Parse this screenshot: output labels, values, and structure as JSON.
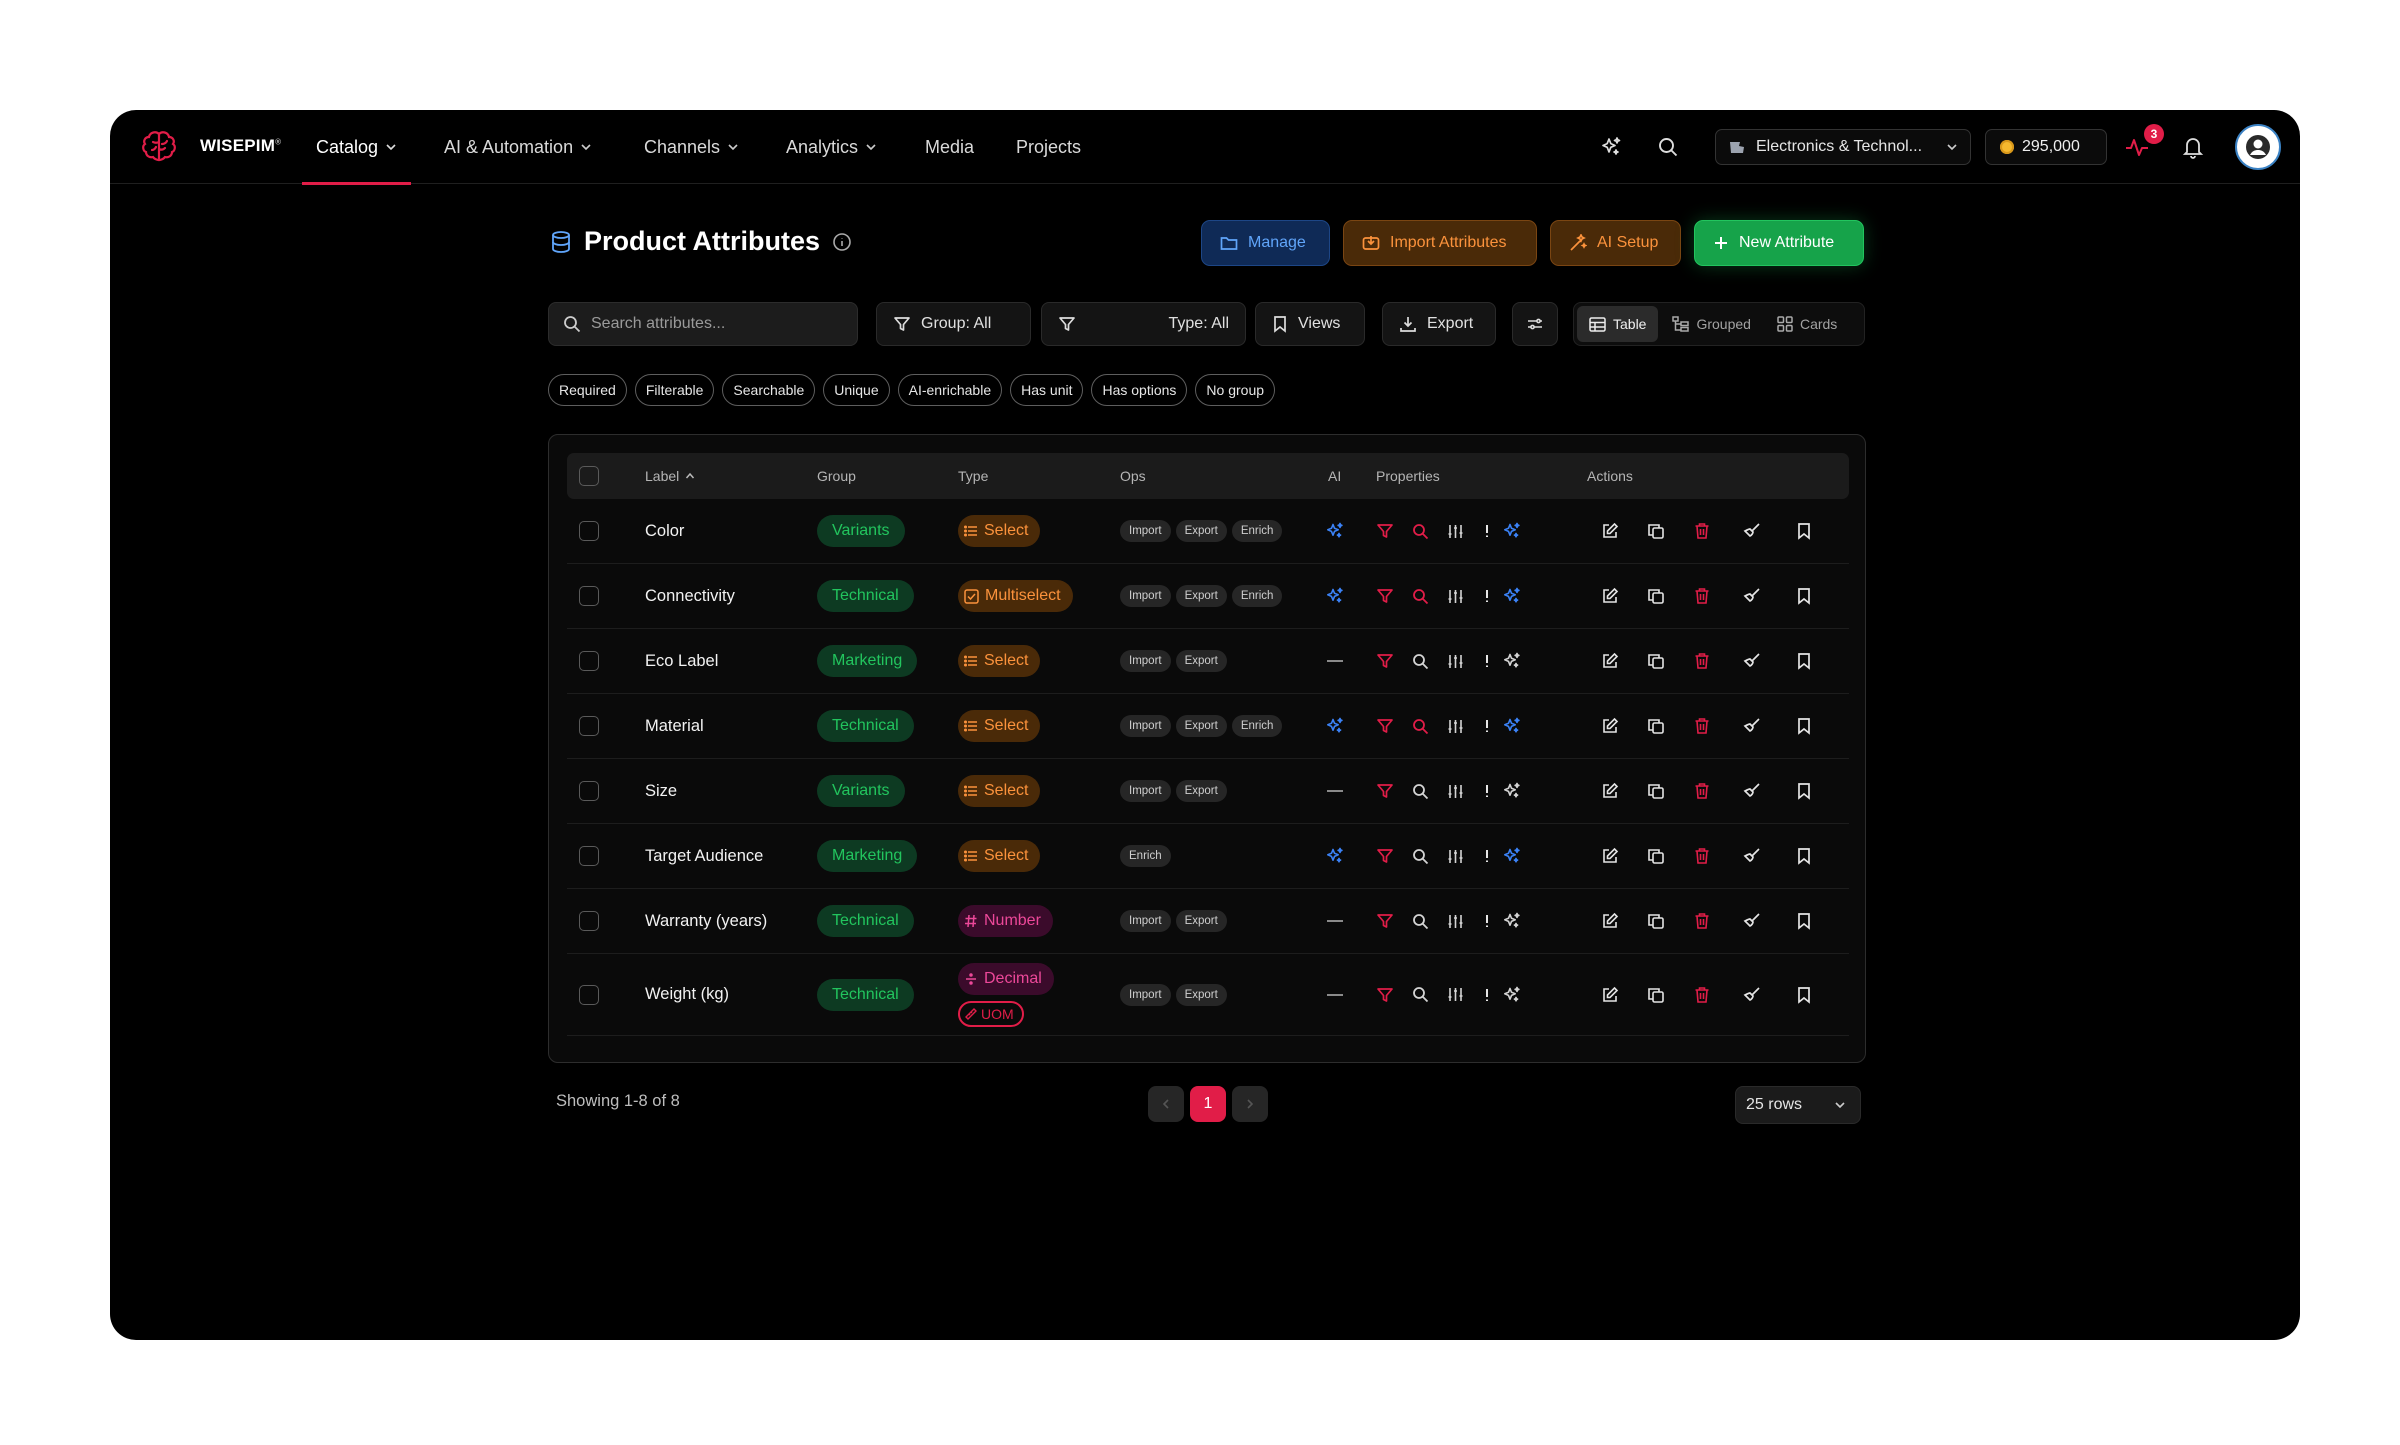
{
  "brand": {
    "name": "WISEPIM",
    "mark": "®"
  },
  "nav": {
    "items": [
      {
        "label": "Catalog",
        "has_menu": true,
        "active": true
      },
      {
        "label": "AI & Automation",
        "has_menu": true
      },
      {
        "label": "Channels",
        "has_menu": true
      },
      {
        "label": "Analytics",
        "has_menu": true
      },
      {
        "label": "Media",
        "has_menu": false
      },
      {
        "label": "Projects",
        "has_menu": false
      }
    ],
    "workspace": "Electronics & Technol...",
    "credits": "295,000",
    "activity_badge": "3"
  },
  "header": {
    "title": "Product Attributes",
    "buttons": {
      "manage": "Manage",
      "import": "Import Attributes",
      "ai_setup": "AI Setup",
      "new": "New Attribute"
    }
  },
  "toolbar": {
    "search_placeholder": "Search attributes...",
    "group_filter": "Group: All",
    "type_filter": "Type: All",
    "views": "Views",
    "export": "Export",
    "view_modes": [
      {
        "label": "Table",
        "active": true
      },
      {
        "label": "Grouped",
        "active": false
      },
      {
        "label": "Cards",
        "active": false
      }
    ]
  },
  "filter_chips": [
    "Required",
    "Filterable",
    "Searchable",
    "Unique",
    "AI-enrichable",
    "Has unit",
    "Has options",
    "No group"
  ],
  "table": {
    "columns": {
      "label": "Label",
      "group": "Group",
      "type": "Type",
      "ops": "Ops",
      "ai": "AI",
      "properties": "Properties",
      "actions": "Actions"
    },
    "rows": [
      {
        "label": "Color",
        "group": "Variants",
        "type": "Select",
        "type_icon": "list-icon",
        "ops": [
          "Import",
          "Export",
          "Enrich"
        ],
        "ai": true,
        "searchable": true
      },
      {
        "label": "Connectivity",
        "group": "Technical",
        "type": "Multiselect",
        "type_icon": "checkbox-icon",
        "ops": [
          "Import",
          "Export",
          "Enrich"
        ],
        "ai": true,
        "searchable": true
      },
      {
        "label": "Eco Label",
        "group": "Marketing",
        "type": "Select",
        "type_icon": "list-icon",
        "ops": [
          "Import",
          "Export"
        ],
        "ai": false,
        "searchable": false
      },
      {
        "label": "Material",
        "group": "Technical",
        "type": "Select",
        "type_icon": "list-icon",
        "ops": [
          "Import",
          "Export",
          "Enrich"
        ],
        "ai": true,
        "searchable": true
      },
      {
        "label": "Size",
        "group": "Variants",
        "type": "Select",
        "type_icon": "list-icon",
        "ops": [
          "Import",
          "Export"
        ],
        "ai": false,
        "searchable": false
      },
      {
        "label": "Target Audience",
        "group": "Marketing",
        "type": "Select",
        "type_icon": "list-icon",
        "ops": [
          "Enrich"
        ],
        "ai": true,
        "searchable": false
      },
      {
        "label": "Warranty (years)",
        "group": "Technical",
        "type": "Number",
        "type_icon": "hash-icon",
        "ops": [
          "Import",
          "Export"
        ],
        "ai": false,
        "searchable": false
      },
      {
        "label": "Weight (kg)",
        "group": "Technical",
        "type": "Decimal",
        "type_icon": "divide-icon",
        "ops": [
          "Import",
          "Export"
        ],
        "ai": false,
        "searchable": false,
        "uom": "UOM"
      }
    ]
  },
  "footer": {
    "showing": "Showing 1-8 of 8",
    "current_page": "1",
    "rows_per_page": "25 rows"
  },
  "colors": {
    "accent_red": "#e11d48",
    "green": "#22c55e",
    "orange": "#fb923c",
    "blue": "#60a5fa",
    "ai_blue": "#3b82f6"
  }
}
